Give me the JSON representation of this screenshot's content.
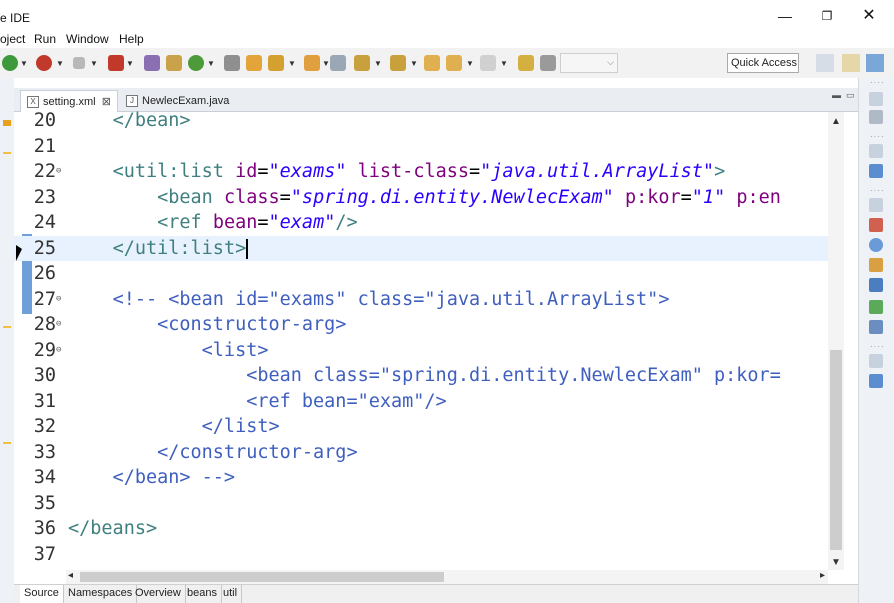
{
  "window": {
    "title": "e IDE",
    "controls": {
      "minimize": "—",
      "maximize": "❐",
      "close": "✕"
    }
  },
  "menu": [
    "oject",
    "Run",
    "Window",
    "Help"
  ],
  "toolbar": {
    "quick_access": "Quick Access"
  },
  "tabs": [
    {
      "label": "setting.xml",
      "active": true,
      "icon": "xml-file-icon",
      "close": "⊠"
    },
    {
      "label": "NewlecExam.java",
      "active": false,
      "icon": "java-file-icon"
    }
  ],
  "editor": {
    "lines": [
      {
        "n": "20",
        "fold": "",
        "html": "    <span class='t-tag'>&lt;/bean&gt;</span>"
      },
      {
        "n": "21",
        "fold": "",
        "html": ""
      },
      {
        "n": "22",
        "fold": "⊖",
        "html": "    <span class='t-tag'>&lt;util:list</span> <span class='t-attr'>id</span><span class='t-plain'>=</span><span class='t-str'>\"exams\"</span> <span class='t-attr'>list-class</span><span class='t-plain'>=</span><span class='t-str'>\"java.util.ArrayList\"</span><span class='t-tag'>&gt;</span>"
      },
      {
        "n": "23",
        "fold": "",
        "html": "        <span class='t-tag'>&lt;bean</span> <span class='t-attr'>class</span><span class='t-plain'>=</span><span class='t-str'>\"spring.di.entity.NewlecExam\"</span> <span class='t-attr'>p:kor</span><span class='t-plain'>=</span><span class='t-str'>\"1\"</span> <span class='t-attr'>p:en</span>"
      },
      {
        "n": "24",
        "fold": "",
        "html": "        <span class='t-tag'>&lt;ref</span> <span class='t-attr'>bean</span><span class='t-plain'>=</span><span class='t-str'>\"exam\"</span><span class='t-tag'>/&gt;</span>"
      },
      {
        "n": "25",
        "fold": "",
        "cur": true,
        "html": "    <span class='t-tag'>&lt;/util:list&gt;</span><span class='cursor'></span>"
      },
      {
        "n": "26",
        "fold": "",
        "html": ""
      },
      {
        "n": "27",
        "fold": "⊖",
        "html": "    <span class='t-com'>&lt;!-- &lt;bean id=\"exams\" class=\"java.util.ArrayList\"&gt;</span>"
      },
      {
        "n": "28",
        "fold": "⊖",
        "html": "<span class='t-com'>        &lt;constructor-arg&gt;</span>"
      },
      {
        "n": "29",
        "fold": "⊖",
        "html": "<span class='t-com'>            &lt;list&gt;</span>"
      },
      {
        "n": "30",
        "fold": "",
        "html": "<span class='t-com'>                &lt;bean class=\"spring.di.entity.NewlecExam\" p:kor=</span>"
      },
      {
        "n": "31",
        "fold": "",
        "html": "<span class='t-com'>                &lt;ref bean=\"exam\"/&gt;</span>"
      },
      {
        "n": "32",
        "fold": "",
        "html": "<span class='t-com'>            &lt;/list&gt;</span>"
      },
      {
        "n": "33",
        "fold": "",
        "html": "<span class='t-com'>        &lt;/constructor-arg&gt;</span>"
      },
      {
        "n": "34",
        "fold": "",
        "html": "<span class='t-com'>    &lt;/bean&gt; --&gt;</span>"
      },
      {
        "n": "35",
        "fold": "",
        "html": ""
      },
      {
        "n": "36",
        "fold": "",
        "html": "<span class='t-tag'>&lt;/beans&gt;</span>"
      },
      {
        "n": "37",
        "fold": "",
        "html": ""
      }
    ]
  },
  "bottom_tabs": [
    {
      "label": "Source",
      "active": true
    },
    {
      "label": "Namespaces",
      "active": false
    },
    {
      "label": "Overview",
      "active": false
    },
    {
      "label": "beans",
      "active": false
    },
    {
      "label": "util",
      "active": false
    }
  ],
  "colors": {
    "tag": "#3f7f7f",
    "attribute": "#7f007f",
    "string": "#2a00ff",
    "comment": "#3f5fbf",
    "current_line": "#e8f2fe"
  }
}
